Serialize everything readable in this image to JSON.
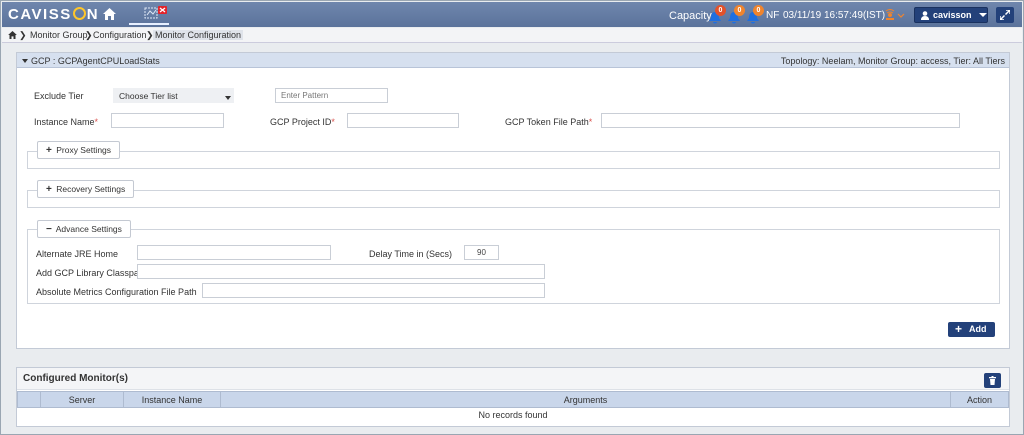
{
  "header": {
    "logo_text_left": "CAVISS",
    "logo_text_right": "N",
    "capacity_label": "Capacity",
    "alerts": [
      {
        "count": "0",
        "color": "#e3522b"
      },
      {
        "count": "0",
        "color": "#f0842d"
      },
      {
        "count": "0",
        "color": "#f0842d"
      }
    ],
    "nf_label": "NF",
    "datetime": "03/11/19 16:57:49(IST)",
    "username": "cavisson"
  },
  "breadcrumb": {
    "items": [
      "Monitor Group",
      "Configuration",
      "Monitor Configuration"
    ]
  },
  "panel": {
    "title": "GCP : GCPAgentCPULoadStats",
    "topology": "Topology: Neelam, Monitor Group: access, Tier: All Tiers",
    "exclude_tier_label": "Exclude Tier",
    "tier_select_value": "Choose Tier list",
    "pattern_placeholder": "Enter Pattern",
    "instance_name_label": "Instance Name",
    "project_id_label": "GCP Project ID",
    "token_path_label": "GCP Token File Path",
    "required_mark": "*",
    "proxy_settings": {
      "symbol": "+",
      "label": "Proxy Settings"
    },
    "recovery_settings": {
      "symbol": "+",
      "label": "Recovery Settings"
    },
    "advance_settings": {
      "symbol": "−",
      "label": "Advance Settings"
    },
    "jre_home_label": "Alternate JRE Home",
    "delay_label": "Delay Time in (Secs)",
    "delay_value": "90",
    "classpath_label": "Add GCP Library Classpath",
    "metrics_path_label": "Absolute Metrics Configuration File Path",
    "add_label": "Add"
  },
  "configured": {
    "title": "Configured Monitor(s)",
    "columns": [
      "",
      "Server",
      "Instance Name",
      "Arguments",
      "Action"
    ],
    "empty_text": "No records found"
  },
  "colors": {
    "topbar": "#5b739b",
    "accent_button": "#23417a",
    "panel_header": "#d6e0ef",
    "table_header": "#c9d6ea",
    "required": "#d9534f"
  }
}
